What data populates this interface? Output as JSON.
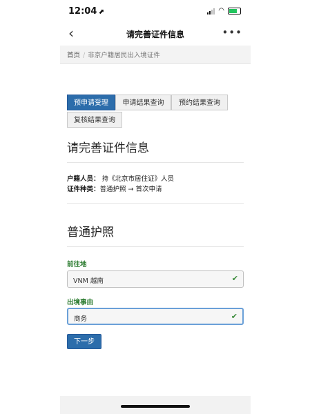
{
  "status": {
    "time": "12:04",
    "location_arrow": "⬈"
  },
  "nav": {
    "back": "‹",
    "title": "请完善证件信息",
    "more": "•••"
  },
  "breadcrumb": {
    "home": "首页",
    "separator": "/",
    "current": "非京户籍居民出入境证件"
  },
  "tabs": [
    {
      "label": "预申请受理",
      "active": true
    },
    {
      "label": "申请结果查询",
      "active": false
    },
    {
      "label": "预约结果查询",
      "active": false
    },
    {
      "label": "复核结果查询",
      "active": false
    }
  ],
  "page": {
    "title": "请完善证件信息"
  },
  "info": {
    "household_label": "户籍人员：",
    "household_value": "持《北京市居住证》人员",
    "type_label": "证件种类：",
    "type_value": "普通护照 → 首次申请"
  },
  "section": {
    "title": "普通护照"
  },
  "form": {
    "destination_label": "前往地",
    "destination_value": "VNM 越南",
    "reason_label": "出境事由",
    "reason_value": "商务",
    "check": "✔",
    "next_label": "下一步"
  },
  "colors": {
    "primary": "#2c6dab",
    "label_green": "#2e7d32",
    "check_green": "#3a8a3a"
  },
  "icons": [
    "back-icon",
    "more-icon",
    "signal-icon",
    "wifi-icon",
    "battery-icon",
    "check-icon"
  ]
}
